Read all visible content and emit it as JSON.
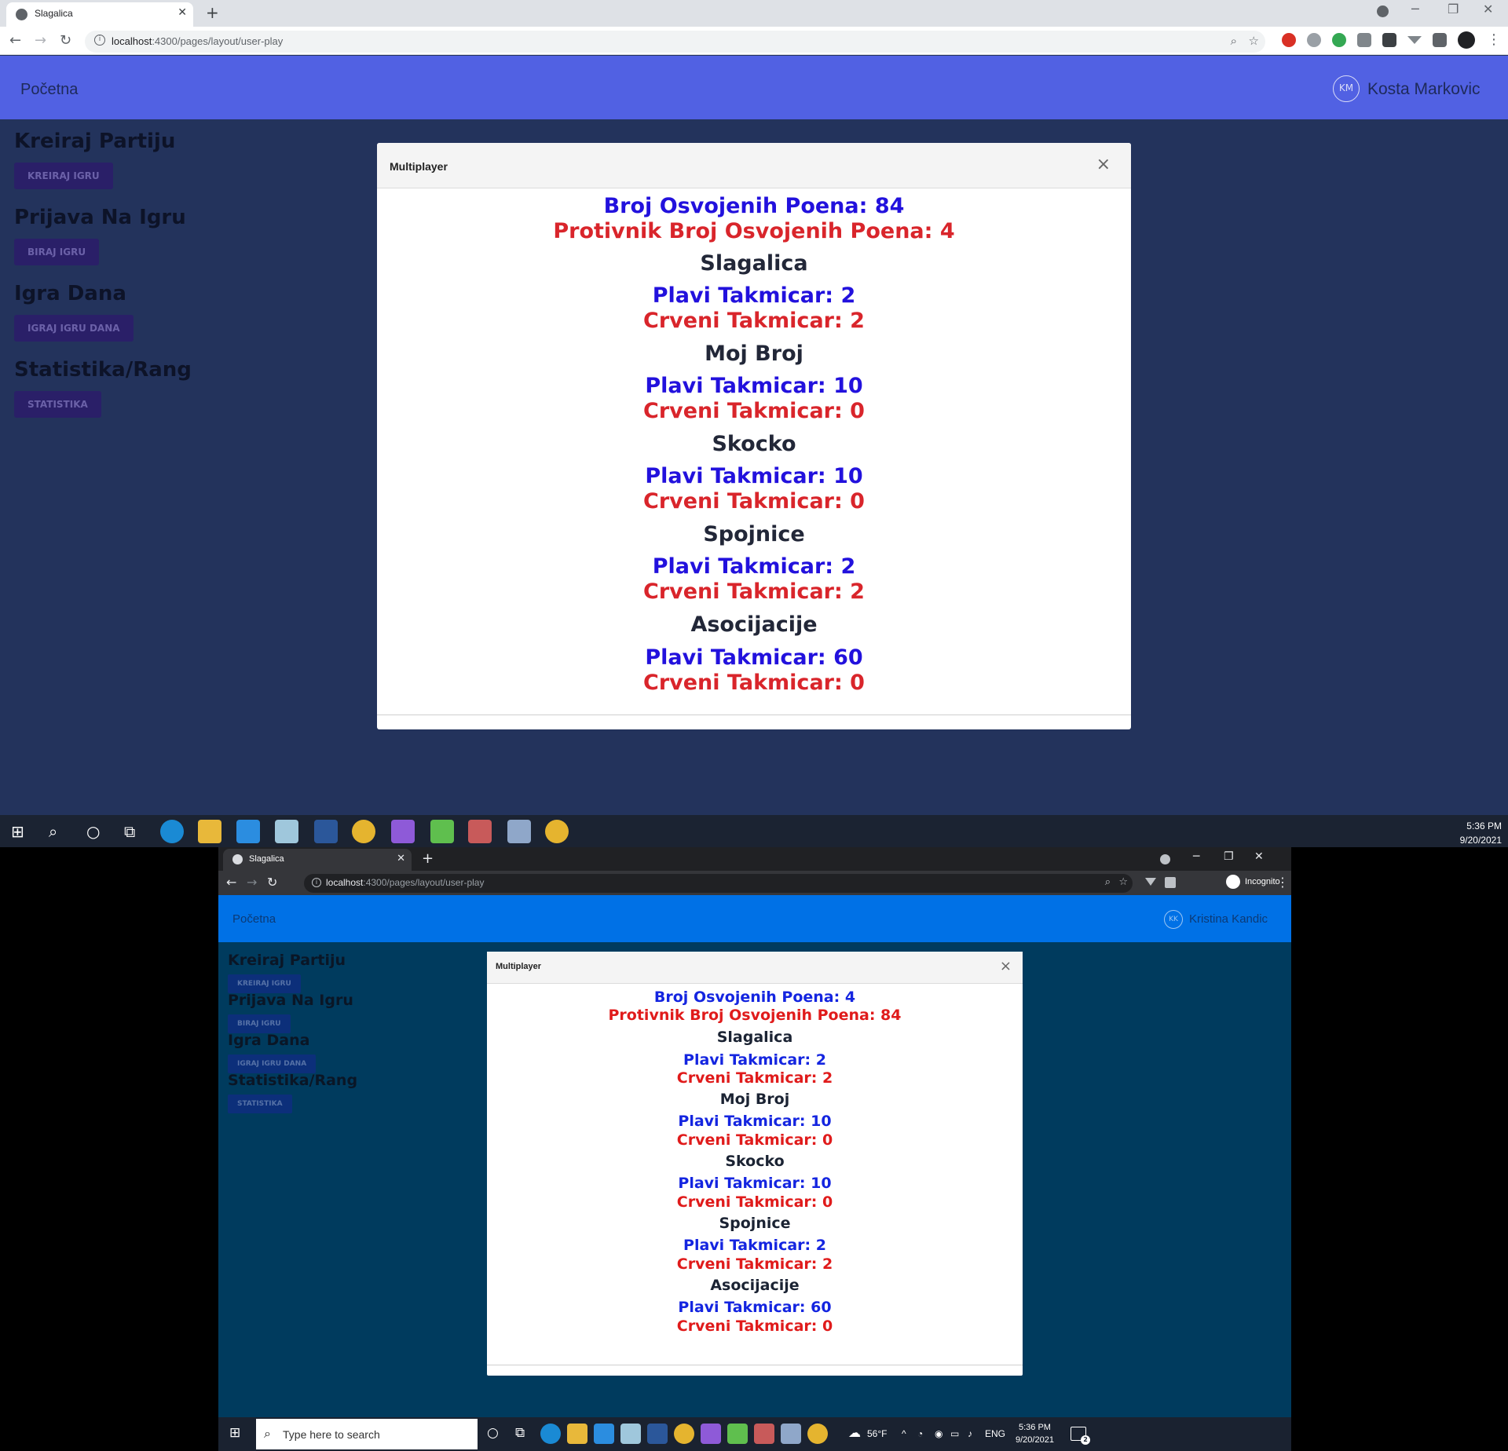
{
  "top": {
    "tab_title": "Slagalica",
    "url_host": "localhost",
    "url_rest": ":4300/pages/layout/user-play",
    "brand": "Početna",
    "avatar_initials": "KM",
    "user_name": "Kosta Markovic",
    "sidebar": [
      {
        "heading": "Kreiraj Partiju",
        "button": "KREIRAJ IGRU"
      },
      {
        "heading": "Prijava Na Igru",
        "button": "BIRAJ IGRU"
      },
      {
        "heading": "Igra Dana",
        "button": "IGRAJ IGRU DANA"
      },
      {
        "heading": "Statistika/Rang",
        "button": "STATISTIKA"
      }
    ],
    "modal": {
      "title": "Multiplayer",
      "close": "×",
      "total_points": "Broj Osvojenih Poena: 84",
      "opponent_points": "Protivnik Broj Osvojenih Poena: 4",
      "games": [
        {
          "name": "Slagalica",
          "blue": "Plavi Takmicar: 2",
          "red": "Crveni Takmicar: 2"
        },
        {
          "name": "Moj Broj",
          "blue": "Plavi Takmicar: 10",
          "red": "Crveni Takmicar: 0"
        },
        {
          "name": "Skocko",
          "blue": "Plavi Takmicar: 10",
          "red": "Crveni Takmicar: 0"
        },
        {
          "name": "Spojnice",
          "blue": "Plavi Takmicar: 2",
          "red": "Crveni Takmicar: 2"
        },
        {
          "name": "Asocijacije",
          "blue": "Plavi Takmicar: 60",
          "red": "Crveni Takmicar: 0"
        }
      ]
    },
    "clock_time": "5:36 PM",
    "clock_date": "9/20/2021"
  },
  "bottom": {
    "tab_title": "Slagalica",
    "url_host": "localhost",
    "url_rest": ":4300/pages/layout/user-play",
    "incognito_label": "Incognito",
    "brand": "Početna",
    "avatar_initials": "KK",
    "user_name": "Kristina Kandic",
    "sidebar": [
      {
        "heading": "Kreiraj Partiju",
        "button": "KREIRAJ IGRU"
      },
      {
        "heading": "Prijava Na Igru",
        "button": "BIRAJ IGRU"
      },
      {
        "heading": "Igra Dana",
        "button": "IGRAJ IGRU DANA"
      },
      {
        "heading": "Statistika/Rang",
        "button": "STATISTIKA"
      }
    ],
    "modal": {
      "title": "Multiplayer",
      "close": "×",
      "total_points": "Broj Osvojenih Poena: 4",
      "opponent_points": "Protivnik Broj Osvojenih Poena: 84",
      "games": [
        {
          "name": "Slagalica",
          "blue": "Plavi Takmicar: 2",
          "red": "Crveni Takmicar: 2"
        },
        {
          "name": "Moj Broj",
          "blue": "Plavi Takmicar: 10",
          "red": "Crveni Takmicar: 0"
        },
        {
          "name": "Skocko",
          "blue": "Plavi Takmicar: 10",
          "red": "Crveni Takmicar: 0"
        },
        {
          "name": "Spojnice",
          "blue": "Plavi Takmicar: 2",
          "red": "Crveni Takmicar: 2"
        },
        {
          "name": "Asocijacije",
          "blue": "Plavi Takmicar: 60",
          "red": "Crveni Takmicar: 0"
        }
      ]
    },
    "taskbar_search_placeholder": "Type here to search",
    "weather": "56°F",
    "language": "ENG",
    "clock_time": "5:36 PM",
    "clock_date": "9/20/2021",
    "notification_count": "2"
  }
}
